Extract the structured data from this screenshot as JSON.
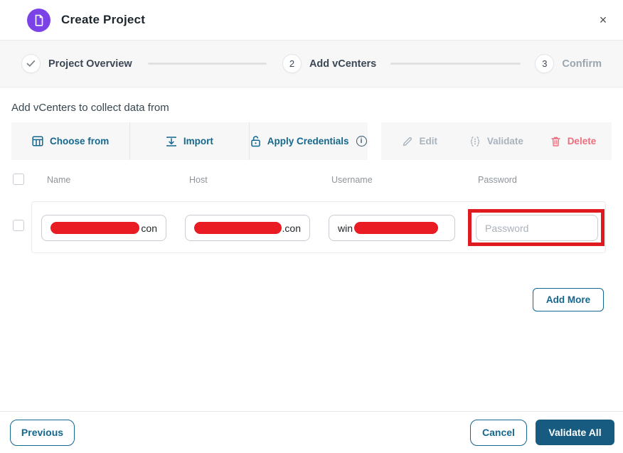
{
  "colors": {
    "accent": "#14678e",
    "primary_button_bg": "#175b80",
    "badge_purple": "#7b42e8",
    "redaction_red": "#e81c22",
    "annotation_red": "#df1b21",
    "disabled_gray": "#a9b3bd",
    "danger_pink": "#ed6f7e"
  },
  "header": {
    "title": "Create Project",
    "close_icon": "×"
  },
  "stepper": {
    "steps": [
      {
        "number": "",
        "label": "Project Overview",
        "state": "done"
      },
      {
        "number": "2",
        "label": "Add vCenters",
        "state": "active"
      },
      {
        "number": "3",
        "label": "Confirm",
        "state": "upcoming"
      }
    ]
  },
  "section_title": "Add vCenters to collect data from",
  "toolbar": {
    "left": [
      {
        "label": "Choose from",
        "icon": "table-grid-icon"
      },
      {
        "label": "Import",
        "icon": "import-icon"
      },
      {
        "label": "Apply Credentials",
        "icon": "unlock-icon",
        "info_icon": "i"
      }
    ],
    "right": [
      {
        "label": "Edit",
        "icon": "pencil-icon",
        "disabled": true
      },
      {
        "label": "Validate",
        "icon": "validate-icon",
        "disabled": true
      },
      {
        "label": "Delete",
        "icon": "trash-icon",
        "danger": true
      }
    ]
  },
  "table": {
    "columns": [
      "Name",
      "Host",
      "Username",
      "Password"
    ],
    "row": {
      "name_redacted": true,
      "name_suffix": "con",
      "host_redacted": true,
      "host_suffix": ".con",
      "username_prefix": "win",
      "username_redacted": true,
      "password_value": "",
      "password_placeholder": "Password",
      "password_highlighted": true
    }
  },
  "add_more_label": "Add More",
  "footer": {
    "previous_label": "Previous",
    "cancel_label": "Cancel",
    "validate_all_label": "Validate All"
  }
}
